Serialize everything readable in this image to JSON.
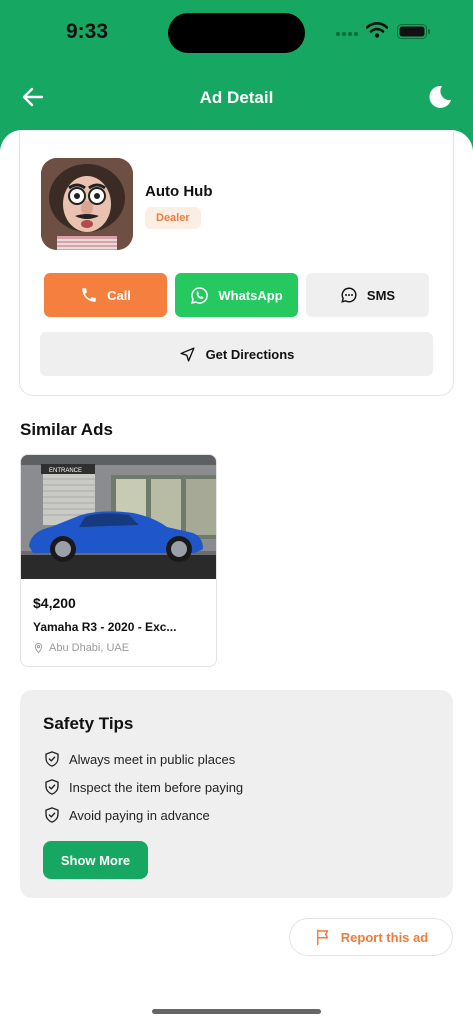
{
  "status_bar": {
    "time": "9:33"
  },
  "nav": {
    "title": "Ad Detail"
  },
  "seller": {
    "name": "Auto Hub",
    "badge": "Dealer"
  },
  "actions": {
    "call": "Call",
    "whatsapp": "WhatsApp",
    "sms": "SMS",
    "directions": "Get Directions"
  },
  "similar_ads": {
    "title": "Similar Ads",
    "items": [
      {
        "price": "$4,200",
        "title": "Yamaha R3 - 2020 - Exc...",
        "location": "Abu Dhabi, UAE",
        "sign_text": "ENTRANCE"
      }
    ]
  },
  "safety": {
    "title": "Safety Tips",
    "tips": [
      "Always meet in public places",
      "Inspect the item before paying",
      "Avoid paying in advance"
    ],
    "show_more": "Show More"
  },
  "report": {
    "label": "Report this ad"
  },
  "colors": {
    "brand_green": "#16a862",
    "accent_orange": "#f57f3e",
    "whatsapp_green": "#25c95f"
  }
}
